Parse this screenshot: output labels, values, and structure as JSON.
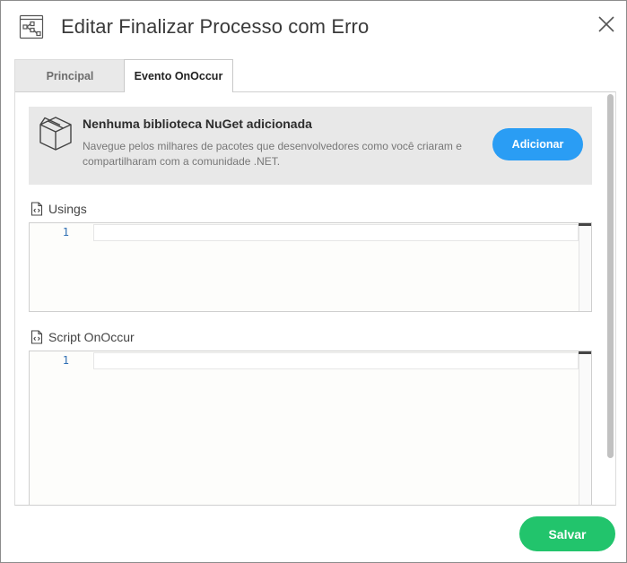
{
  "dialog": {
    "title": "Editar Finalizar Processo com Erro",
    "header_icon": "flow-diagram-icon",
    "close_icon": "close-icon"
  },
  "tabs": [
    {
      "label": "Principal",
      "active": false
    },
    {
      "label": "Evento OnOccur",
      "active": true
    }
  ],
  "nuget": {
    "icon": "package-box-icon",
    "title": "Nenhuma biblioteca NuGet adicionada",
    "description": "Navegue pelos milhares de pacotes que desenvolvedores como você criaram e compartilharam com a comunidade .NET.",
    "add_label": "Adicionar"
  },
  "usings": {
    "label": "Usings",
    "icon": "code-file-icon",
    "line_number": "1",
    "value": ""
  },
  "script": {
    "label": "Script OnOccur",
    "icon": "code-file-icon",
    "line_number": "1",
    "value": ""
  },
  "footer": {
    "save_label": "Salvar"
  },
  "colors": {
    "accent_blue": "#2a9df4",
    "save_green": "#22c46c",
    "panel_gray": "#e8e8e8"
  }
}
